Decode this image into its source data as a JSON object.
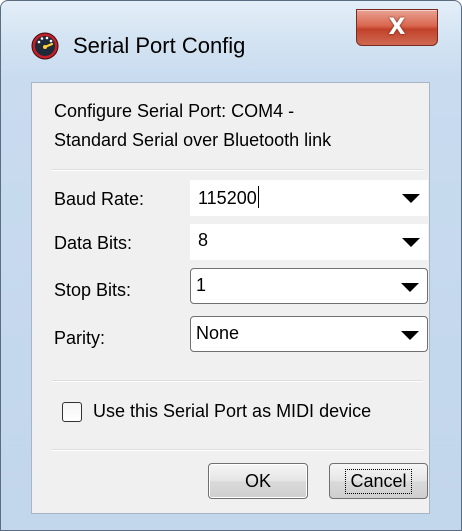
{
  "window": {
    "title": "Serial Port Config",
    "close_label": "X"
  },
  "dialog": {
    "description_line1": "Configure Serial Port: COM4 -",
    "description_line2": "Standard Serial over Bluetooth link",
    "baud_rate": {
      "label": "Baud Rate:",
      "value": "115200"
    },
    "data_bits": {
      "label": "Data Bits:",
      "value": "8"
    },
    "stop_bits": {
      "label": "Stop Bits:",
      "value": "1"
    },
    "parity": {
      "label": "Parity:",
      "value": "None"
    },
    "midi_checkbox": {
      "label": "Use this Serial Port as MIDI device",
      "checked": false
    },
    "ok_label": "OK",
    "cancel_label": "Cancel"
  },
  "icons": {
    "app": "dial-gauge-icon",
    "close": "close-icon",
    "dropdown": "dropdown-arrow-icon"
  },
  "colors": {
    "close_button": "#c2412a",
    "frame": "#c8dbef",
    "client": "#f0f0f0"
  }
}
